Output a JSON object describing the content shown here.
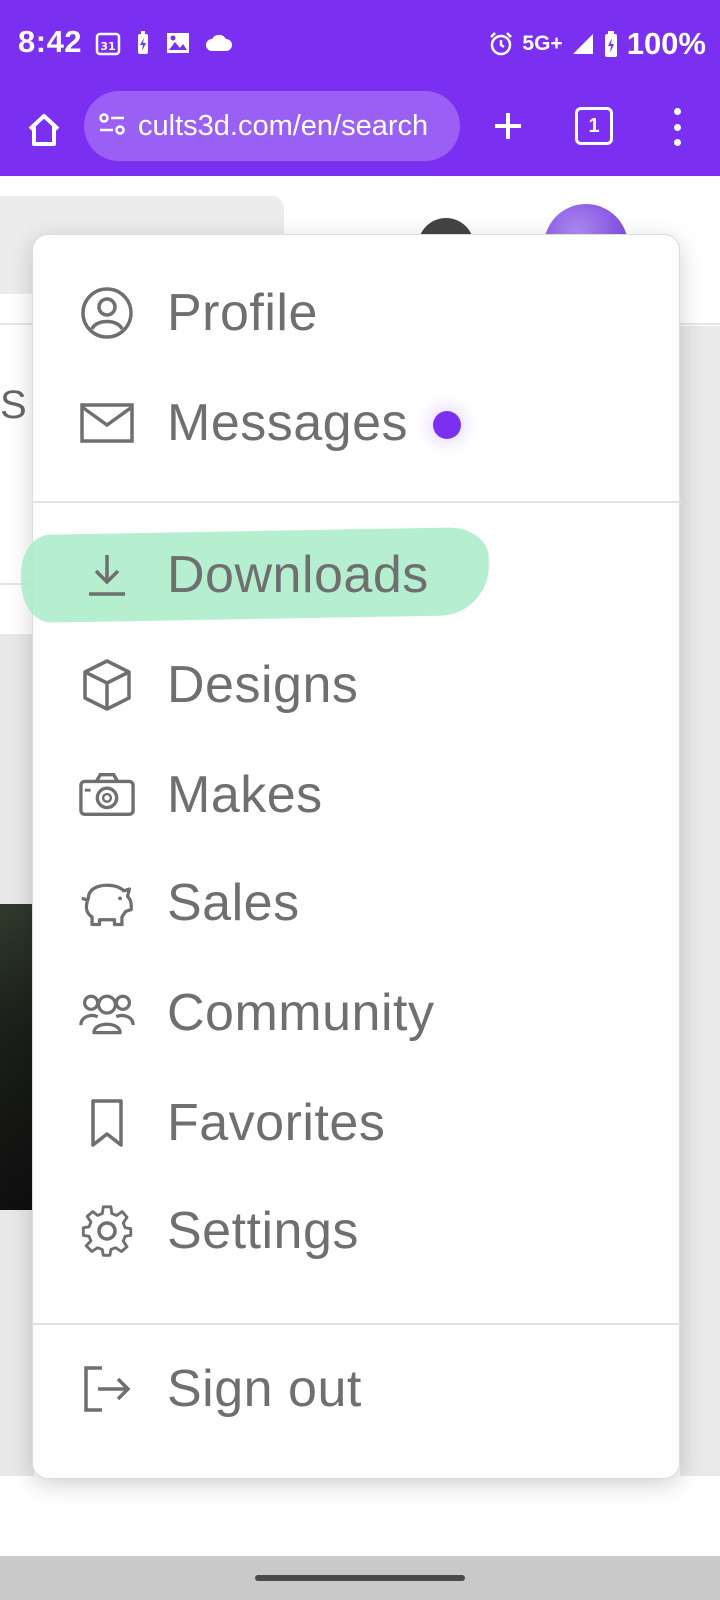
{
  "status_bar": {
    "time": "8:42",
    "calendar_badge": "31",
    "network": "5G+",
    "battery": "100%"
  },
  "browser": {
    "url": "cults3d.com/en/search",
    "tab_count": "1"
  },
  "background": {
    "partial_text": "S"
  },
  "menu": {
    "items": [
      {
        "label": "Profile",
        "icon": "person-circle-icon"
      },
      {
        "label": "Messages",
        "icon": "envelope-icon",
        "unread": true
      },
      {
        "label": "Downloads",
        "icon": "download-icon",
        "highlighted": true
      },
      {
        "label": "Designs",
        "icon": "cube-icon"
      },
      {
        "label": "Makes",
        "icon": "camera-icon"
      },
      {
        "label": "Sales",
        "icon": "piggy-bank-icon"
      },
      {
        "label": "Community",
        "icon": "people-icon"
      },
      {
        "label": "Favorites",
        "icon": "bookmark-icon"
      },
      {
        "label": "Settings",
        "icon": "gear-icon"
      },
      {
        "label": "Sign out",
        "icon": "sign-out-icon"
      }
    ]
  },
  "colors": {
    "accent": "#7b2ff0",
    "highlight": "#a8ecc8",
    "menu_text": "#6f6f6f"
  }
}
